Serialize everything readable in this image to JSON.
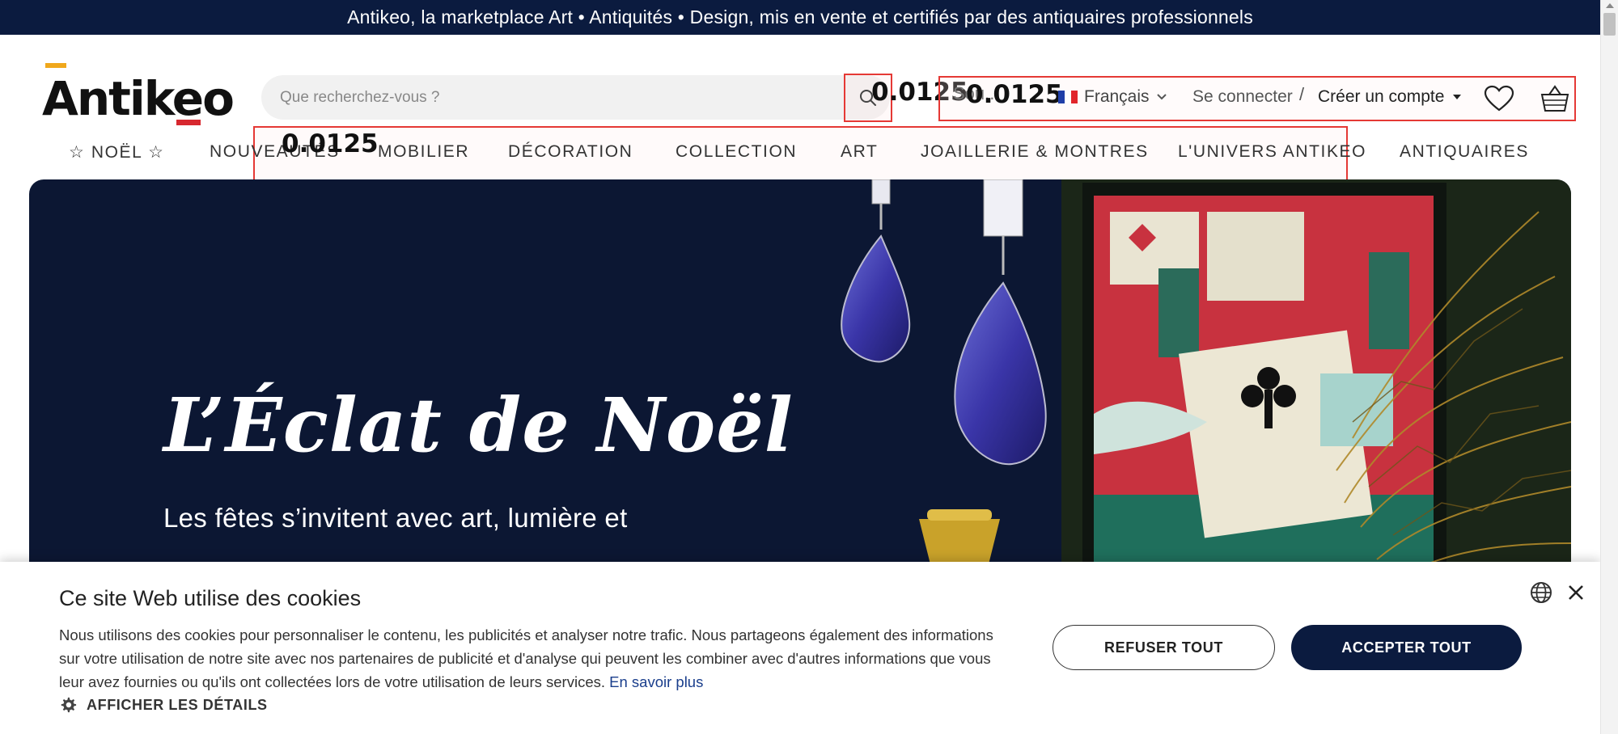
{
  "announcement": "Antikeo, la marketplace Art • Antiquités • Design, mis en vente et certifiés par des antiquaires professionnels",
  "logo": {
    "text": "Antikeo"
  },
  "search": {
    "placeholder": "Que recherchez-vous ?",
    "value": ""
  },
  "annotations": {
    "search_button": "0.0125",
    "header_tools": "0.0125",
    "nav": "0.0125"
  },
  "overlay_partial_text": "Sou...",
  "header": {
    "language": "Français",
    "login": "Se connecter",
    "separator": "/",
    "register": "Créer un compte"
  },
  "nav": {
    "items": [
      "☆ NOËL ☆",
      "NOUVEAUTÉS",
      "MOBILIER",
      "DÉCORATION",
      "COLLECTION",
      "ART",
      "JOAILLERIE & MONTRES",
      "L'UNIVERS ANTIKEO",
      "ANTIQUAIRES"
    ]
  },
  "hero": {
    "title": "L’Éclat de Noël",
    "subtitle": "Les fêtes s’invitent avec art, lumière et"
  },
  "cookie": {
    "title": "Ce site Web utilise des cookies",
    "body": "Nous utilisons des cookies pour personnaliser le contenu, les publicités et analyser notre trafic. Nous partageons également des informations sur votre utilisation de notre site avec nos partenaires de publicité et d'analyse qui peuvent les combiner avec d'autres informations que vous leur avez fournies ou qu'ils ont collectées lors de votre utilisation de leurs services.",
    "learn_more": "En savoir plus",
    "details": "AFFICHER LES DÉTAILS",
    "refuse": "REFUSER TOUT",
    "accept": "ACCEPTER TOUT"
  },
  "colors": {
    "navy": "#0b1b3f",
    "hero_bg": "#0c1733",
    "annotation_red": "#e53935",
    "logo_orange": "#f0a81c",
    "logo_red": "#d7282f"
  }
}
